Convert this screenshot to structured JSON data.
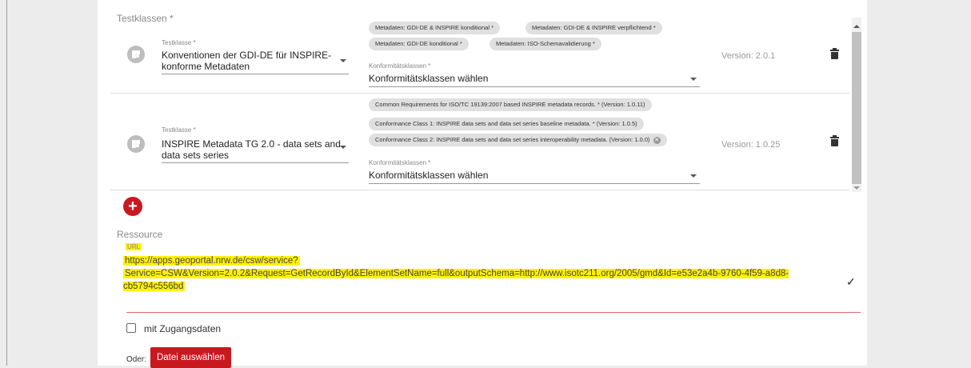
{
  "testklassen": {
    "section_label": "Testklassen *",
    "rows": [
      {
        "testklasse_label": "Testklasse *",
        "testklasse_value_line1": "Konventionen der GDI-DE für INSPIRE-",
        "testklasse_value_line2": "konforme Metadaten",
        "chips": [
          "Metadaten: GDI-DE & INSPIRE konditional *",
          "Metadaten: GDI-DE & INSPIRE verpflichtend *",
          "Metadaten: GDI-DE konditional *",
          "Metadaten: ISO-Schemavalidierung *"
        ],
        "konf_label": "Konformitätsklassen *",
        "konf_value": "Konformitätsklassen wählen",
        "version": "Version: 2.0.1"
      },
      {
        "testklasse_label": "Testklasse *",
        "testklasse_value_line1": "INSPIRE Metadata TG 2.0 - data sets and",
        "testklasse_value_line2": "data sets series",
        "chips": [
          "Common Requirements for ISO/TC 19139:2007 based INSPIRE metadata records. * (Version: 1.0.11)",
          "Conformance Class 1: INSPIRE data sets and data set series baseline metadata. * (Version: 1.0.5)",
          "Conformance Class 2: INSPIRE data sets and data set series interoperability metadata. (Version: 1.0.0)"
        ],
        "konf_label": "Konformitätsklassen *",
        "konf_value": "Konformitätsklassen wählen",
        "version": "Version: 1.0.25"
      }
    ]
  },
  "ressource": {
    "section_label": "Ressource",
    "url_label": "URL",
    "url_line1": "https://apps.geoportal.nrw.de/csw/service?",
    "url_line2": "Service=CSW&Version=2.0.2&Request=GetRecordById&ElementSetName=full&outputSchema=http://www.isotc211.org/2005/gmd&Id=e53e2a4b-9760-4f59-a8d8-cb5794c556bd"
  },
  "zugang": {
    "checkbox_label": "mit Zugangsdaten"
  },
  "file": {
    "oder_label": "Oder:",
    "button_label": "Datei auswählen"
  },
  "colors": {
    "accent": "#c8191f",
    "highlight": "#fff200"
  }
}
